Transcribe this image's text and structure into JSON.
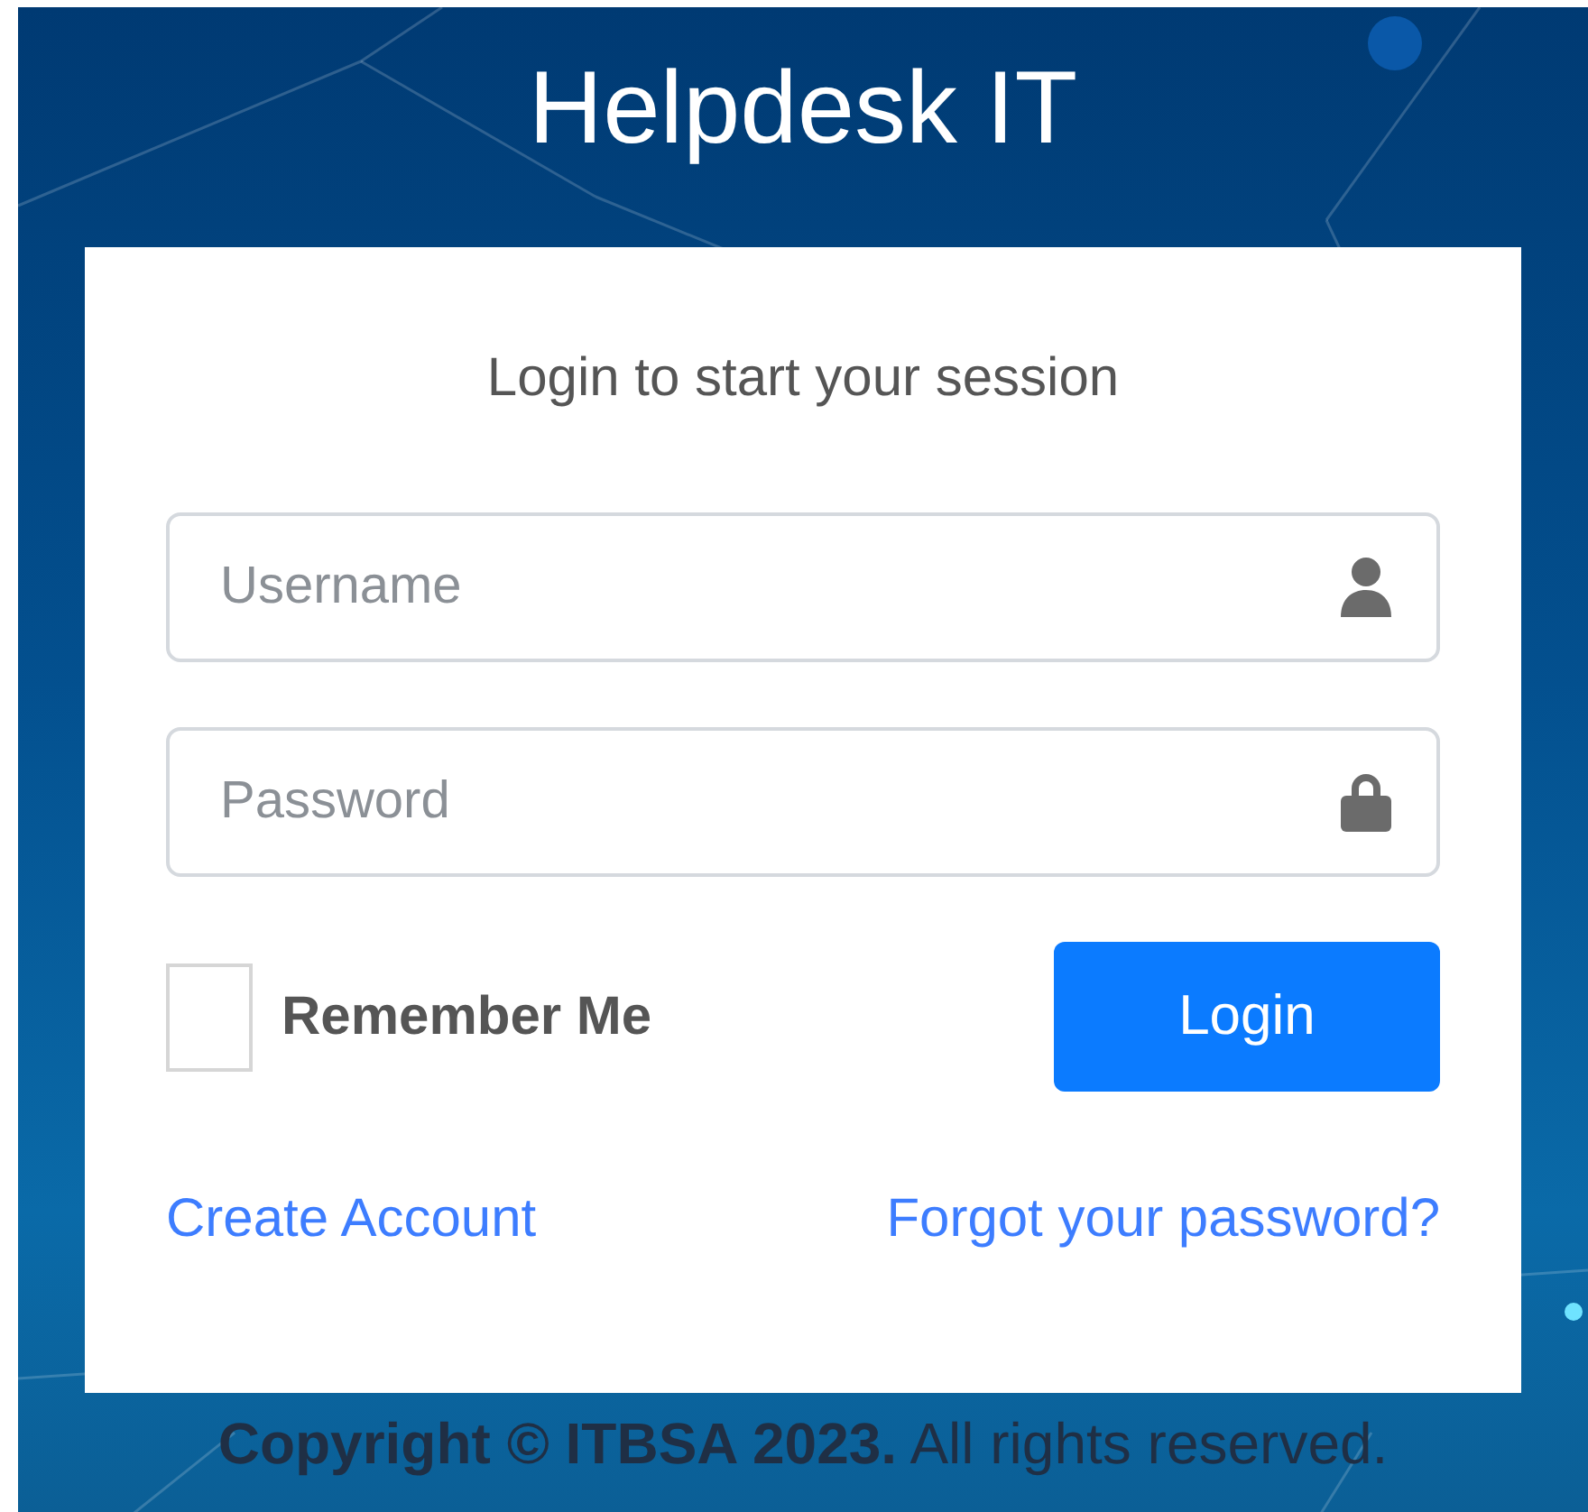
{
  "logo": {
    "bold": "Helpdesk",
    "light": "IT"
  },
  "login_box": {
    "message": "Login to start your session",
    "fields": [
      {
        "kind": "text",
        "placeholder": "Username"
      },
      {
        "kind": "password",
        "placeholder": "Password"
      }
    ],
    "remember": {
      "label": "Remember Me",
      "checked": false
    },
    "submit": "Login",
    "links": [
      "Create Account",
      "Forgot your password?"
    ]
  },
  "footer": "**Copyright © ITBSA 2023.** All rights reserved."
}
